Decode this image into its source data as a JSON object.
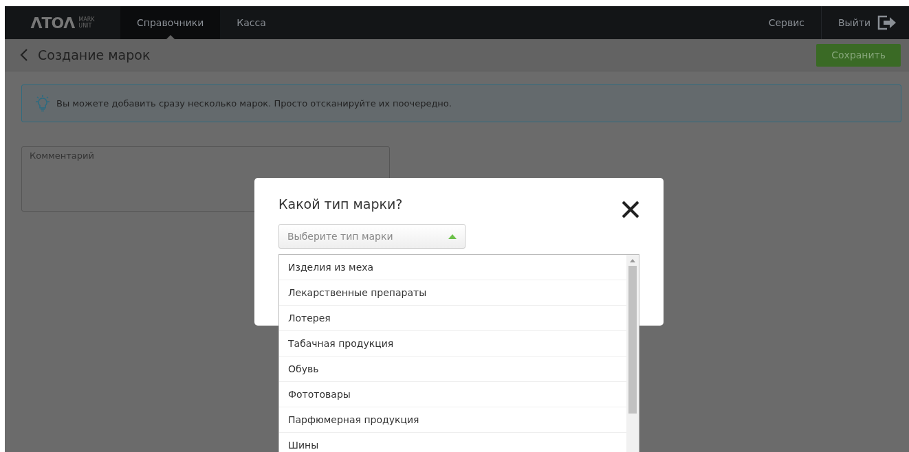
{
  "navbar": {
    "logo": "ΛTOΛ",
    "logo_sub": [
      "MARK",
      "UNIT"
    ],
    "tabs": [
      {
        "label": "Справочники",
        "selected": true
      },
      {
        "label": "Касса",
        "selected": false
      }
    ],
    "right": [
      {
        "label": "Сервис",
        "kind": "link"
      },
      {
        "label": "Выйти",
        "kind": "exit"
      }
    ]
  },
  "page_header": {
    "title": "Создание марок",
    "save_button": "Сохранить"
  },
  "info": "Вы можете добавить сразу несколько марок. Просто отсканируйте их поочередно.",
  "comment_field": {
    "placeholder": "Комментарий"
  },
  "modal": {
    "title": "Какой тип марки?",
    "select": {
      "placeholder": "Выберите тип марки",
      "expanded": true
    },
    "options": [
      {
        "label": "Изделия из меха",
        "selected": false
      },
      {
        "label": "Лекарственные препараты",
        "selected": false
      },
      {
        "label": "Лотерея",
        "selected": false
      },
      {
        "label": "Табачная продукция",
        "selected": false
      },
      {
        "label": "Обувь",
        "selected": false
      },
      {
        "label": "Фототовары",
        "selected": false
      },
      {
        "label": "Парфюмерная продукция",
        "selected": false
      },
      {
        "label": "Шины",
        "selected": false
      }
    ]
  }
}
